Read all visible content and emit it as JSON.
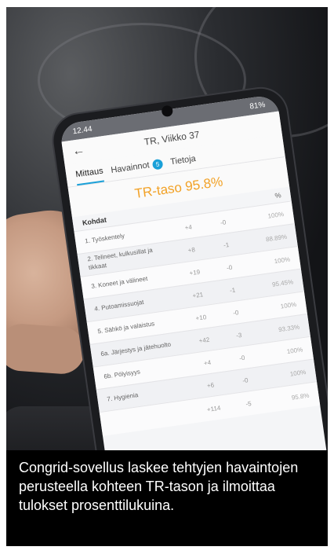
{
  "status": {
    "time": "12.44",
    "battery": "81%"
  },
  "app": {
    "title": "TR, Viikko 37"
  },
  "tabs": [
    {
      "label": "Mittaus",
      "active": true
    },
    {
      "label": "Havainnot",
      "badge": "5",
      "active": false
    },
    {
      "label": "Tietoja",
      "active": false
    }
  ],
  "level_text": "TR-taso 95.8%",
  "table": {
    "header_name": "Kohdat",
    "header_percent": "%",
    "rows": [
      {
        "name": "1. Työskentely",
        "plus": "+4",
        "minus": "-0",
        "percent": "100%"
      },
      {
        "name": "2. Telineet, kulkusillat ja tikkaat",
        "plus": "+8",
        "minus": "-1",
        "percent": "88.89%"
      },
      {
        "name": "3. Koneet ja välineet",
        "plus": "+19",
        "minus": "-0",
        "percent": "100%"
      },
      {
        "name": "4. Putoamissuojat",
        "plus": "+21",
        "minus": "-1",
        "percent": "95.45%"
      },
      {
        "name": "5. Sähkö ja valaistus",
        "plus": "+10",
        "minus": "-0",
        "percent": "100%"
      },
      {
        "name": "6a. Järjestys ja jätehuolto",
        "plus": "+42",
        "minus": "-3",
        "percent": "93.33%"
      },
      {
        "name": "6b. Pölyisyys",
        "plus": "+4",
        "minus": "-0",
        "percent": "100%"
      },
      {
        "name": "7. Hygienia",
        "plus": "+6",
        "minus": "-0",
        "percent": "100%"
      }
    ],
    "total": {
      "plus": "+114",
      "minus": "-5",
      "percent": "95.8%"
    }
  },
  "caption": "Congrid-sovellus laskee tehtyjen havaintojen perusteella kohteen TR-tason ja ilmoittaa tulokset prosenttilukuina.",
  "colors": {
    "accent": "#1aa0d8",
    "level": "#f2a227",
    "caption_bg": "#000000"
  }
}
